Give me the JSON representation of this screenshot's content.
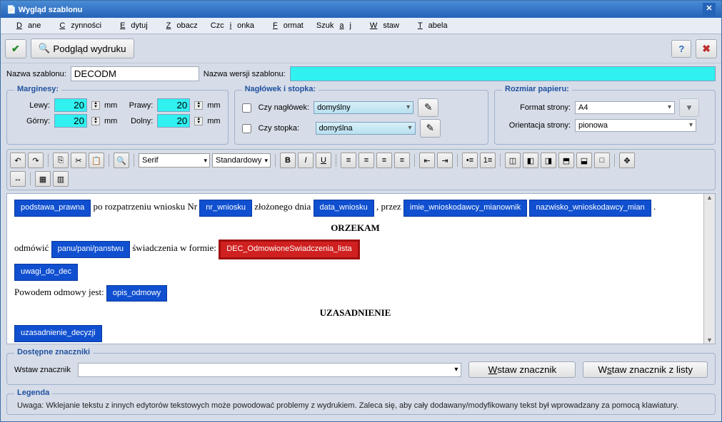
{
  "title": "Wygląd szablonu",
  "menu": [
    "Dane",
    "Czynności",
    "Edytuj",
    "Zobacz",
    "Czcionka",
    "Format",
    "Szukaj",
    "Wstaw",
    "Tabela"
  ],
  "toolbar1": {
    "preview": "Podgląd wydruku"
  },
  "names": {
    "templateNameLabel": "Nazwa szablonu:",
    "templateName": "DECODM",
    "versionNameLabel": "Nazwa wersji szablonu:",
    "versionName": ""
  },
  "margins": {
    "legend": "Marginesy:",
    "leftLabel": "Lewy:",
    "left": "20",
    "leftUnit": "mm",
    "rightLabel": "Prawy:",
    "right": "20",
    "rightUnit": "mm",
    "topLabel": "Górny:",
    "top": "20",
    "topUnit": "mm",
    "bottomLabel": "Dolny:",
    "bottom": "20",
    "bottomUnit": "mm"
  },
  "headerFooter": {
    "legend": "Nagłówek i stopka:",
    "headerLabel": "Czy nagłówek:",
    "headerValue": "domyślny",
    "footerLabel": "Czy stopka:",
    "footerValue": "domyślna"
  },
  "paper": {
    "legend": "Rozmiar papieru:",
    "formatLabel": "Format strony:",
    "format": "A4",
    "orientLabel": "Orientacja strony:",
    "orient": "pionowa"
  },
  "editorToolbar": {
    "font": "Serif",
    "style": "Standardowy"
  },
  "doc": {
    "line1a": " po rozpatrzeniu wniosku Nr ",
    "line1b": " złożonego dnia ",
    "line1c": ", przez ",
    "tag_podstawa": "podstawa_prawna",
    "tag_nrwniosku": "nr_wniosku",
    "tag_datawniosku": "data_wniosku",
    "tag_imie": "imie_wnioskodawcy_mianownik",
    "tag_nazwisko": "nazwisko_wnioskodawcy_mian",
    "orzekam": "ORZEKAM",
    "line2a": "odmówić ",
    "tag_panu": "panu/pani/panstwu",
    "line2b": " świadczenia w formie:",
    "tag_red": "DEC_OdmowioneSwiadczenia_lista",
    "tag_uwagi": "uwagi_do_dec",
    "line3a": "Powodem odmowy jest: ",
    "tag_opis": "opis_odmowy",
    "uzasadnienie": "UZASADNIENIE",
    "tag_uzdec": "uzasadnienie_decyzji"
  },
  "markers": {
    "legend": "Dostępne znaczniki",
    "insertLabel": "Wstaw znacznik",
    "btnInsert": "Wstaw znacznik",
    "btnInsertList": "Wstaw znacznik z listy"
  },
  "legend": {
    "legend": "Legenda",
    "note": "Uwaga: Wklejanie tekstu z innych edytorów tekstowych może powodować problemy z wydrukiem. Zaleca się, aby cały dodawany/modyfikowany tekst był wprowadzany za pomocą klawiatury."
  }
}
